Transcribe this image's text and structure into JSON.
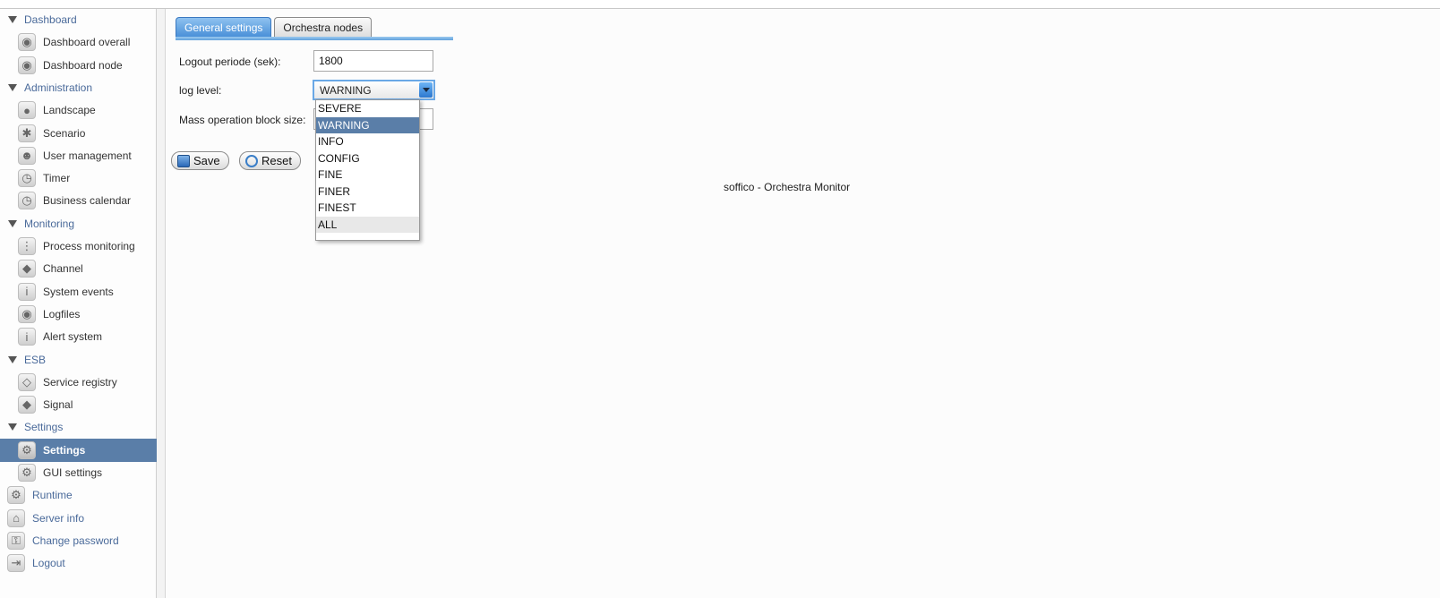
{
  "sidebar": {
    "sections": [
      {
        "label": "Dashboard",
        "items": [
          {
            "label": "Dashboard overall",
            "icon": "dashboard-icon"
          },
          {
            "label": "Dashboard node",
            "icon": "dashboard-icon"
          }
        ]
      },
      {
        "label": "Administration",
        "items": [
          {
            "label": "Landscape",
            "icon": "globe-icon"
          },
          {
            "label": "Scenario",
            "icon": "scenario-icon"
          },
          {
            "label": "User management",
            "icon": "user-icon"
          },
          {
            "label": "Timer",
            "icon": "clock-icon"
          },
          {
            "label": "Business calendar",
            "icon": "clock-icon"
          }
        ]
      },
      {
        "label": "Monitoring",
        "items": [
          {
            "label": "Process monitoring",
            "icon": "process-icon"
          },
          {
            "label": "Channel",
            "icon": "channel-icon"
          },
          {
            "label": "System events",
            "icon": "info-icon"
          },
          {
            "label": "Logfiles",
            "icon": "logfile-icon"
          },
          {
            "label": "Alert system",
            "icon": "info-icon"
          }
        ]
      },
      {
        "label": "ESB",
        "items": [
          {
            "label": "Service registry",
            "icon": "registry-icon"
          },
          {
            "label": "Signal",
            "icon": "signal-icon"
          }
        ]
      },
      {
        "label": "Settings",
        "items": [
          {
            "label": "Settings",
            "icon": "gears-icon",
            "active": true
          },
          {
            "label": "GUI settings",
            "icon": "gears-icon"
          }
        ]
      }
    ],
    "roots": [
      {
        "label": "Runtime",
        "icon": "runtime-icon"
      },
      {
        "label": "Server info",
        "icon": "server-icon"
      },
      {
        "label": "Change password",
        "icon": "key-icon"
      },
      {
        "label": "Logout",
        "icon": "logout-icon"
      }
    ]
  },
  "tabs": [
    {
      "label": "General settings",
      "active": true
    },
    {
      "label": "Orchestra nodes",
      "active": false
    }
  ],
  "form": {
    "logout_label": "Logout periode (sek):",
    "logout_value": "1800",
    "loglevel_label": "log level:",
    "loglevel_value": "WARNING",
    "mass_label": "Mass operation block size:",
    "mass_value": ""
  },
  "dropdown_options": [
    "SEVERE",
    "WARNING",
    "INFO",
    "CONFIG",
    "FINE",
    "FINER",
    "FINEST",
    "ALL"
  ],
  "buttons": {
    "save": "Save",
    "reset": "Reset"
  },
  "footer": "soffico - Orchestra Monitor"
}
